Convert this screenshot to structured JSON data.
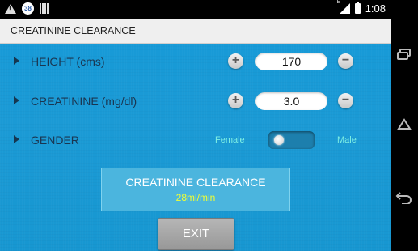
{
  "status_bar": {
    "notification_badge": "38",
    "signal_label": "E",
    "time": "1:08"
  },
  "app": {
    "title": "CREATININE CLEARANCE"
  },
  "height": {
    "label": "HEIGHT (cms)",
    "value": "170",
    "plus": "+",
    "minus": "−"
  },
  "creatinine": {
    "label": "CREATININE (mg/dl)",
    "value": "3.0",
    "plus": "+",
    "minus": "−"
  },
  "gender": {
    "label": "GENDER",
    "option_left": "Female",
    "option_right": "Male"
  },
  "result": {
    "title": "CREATININE CLEARANCE",
    "value": "28ml/min"
  },
  "exit_label": "EXIT",
  "colors": {
    "background": "#1a9ad6",
    "result_value": "#f0ff33",
    "gender_text": "#7ff0e4"
  }
}
